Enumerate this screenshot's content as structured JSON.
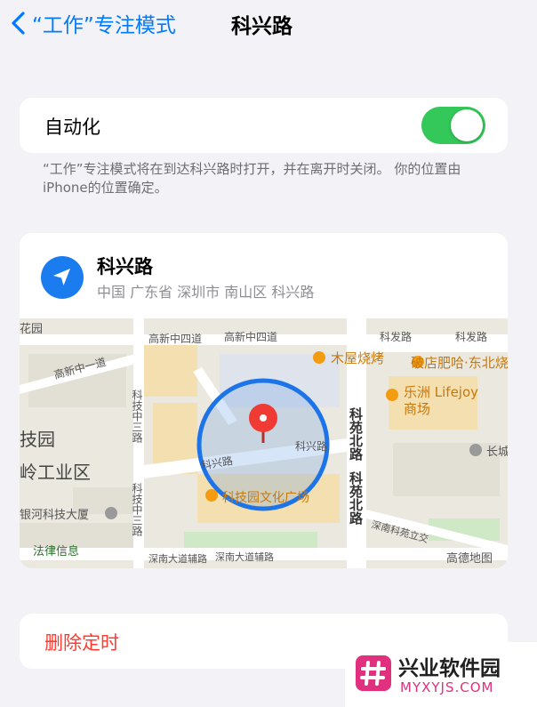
{
  "nav": {
    "back_label": "“工作”专注模式",
    "title": "科兴路"
  },
  "automation": {
    "label": "自动化",
    "enabled": true
  },
  "footnote": "“工作”专注模式将在到达科兴路时打开，并在离开时关闭。 你的位置由iPhone的位置确定。",
  "location": {
    "name": "科兴路",
    "address": "中国 广东省 深圳市 南山区 科兴路"
  },
  "map": {
    "labels": {
      "huayuan": "花园",
      "gaoxin_zhongsi_1": "高新中四道",
      "gaoxin_zhongsi_2": "高新中四道",
      "kefa_road": "科发路",
      "kefa_road_2": "科发路",
      "gaoxin_zhongyi": "高新中一道",
      "mu_wu": "木屋烧烤",
      "po_dian": "破店肥哈·东北烧",
      "lezhou": "乐洲 Lifejoy",
      "shangchang": "商场",
      "kejizhong_1": "科技中三路",
      "kejizhong_2": "科技中三路",
      "keyuan_north_1": "科苑北路",
      "keyuan_north_2": "科苑北路",
      "keji_yuan": "技园",
      "ling_gongye": "岭工业区",
      "yinhe": "银河科技大厦",
      "kexing_road_1": "科兴路",
      "kexing_road_2": "科兴路",
      "keji_park": "科技园文化广场",
      "changcheng": "长城",
      "keyuan_jiao": "深南科苑立交",
      "falu": "法律信息",
      "shennan_fu": "深南大道辅路",
      "shennan_fu_2": "深南大道辅路",
      "gaode": "高德地图",
      "shennan_bottom": "深南科苑立交"
    }
  },
  "delete": {
    "label": "删除定时"
  },
  "watermark": {
    "name": "兴业软件园",
    "url": "MYXYJS.COM"
  },
  "colors": {
    "accent": "#007aff",
    "toggle_on": "#34c759",
    "destructive": "#ff3b30",
    "location_icon": "#1b7cf0",
    "watermark": "#e0307e"
  }
}
